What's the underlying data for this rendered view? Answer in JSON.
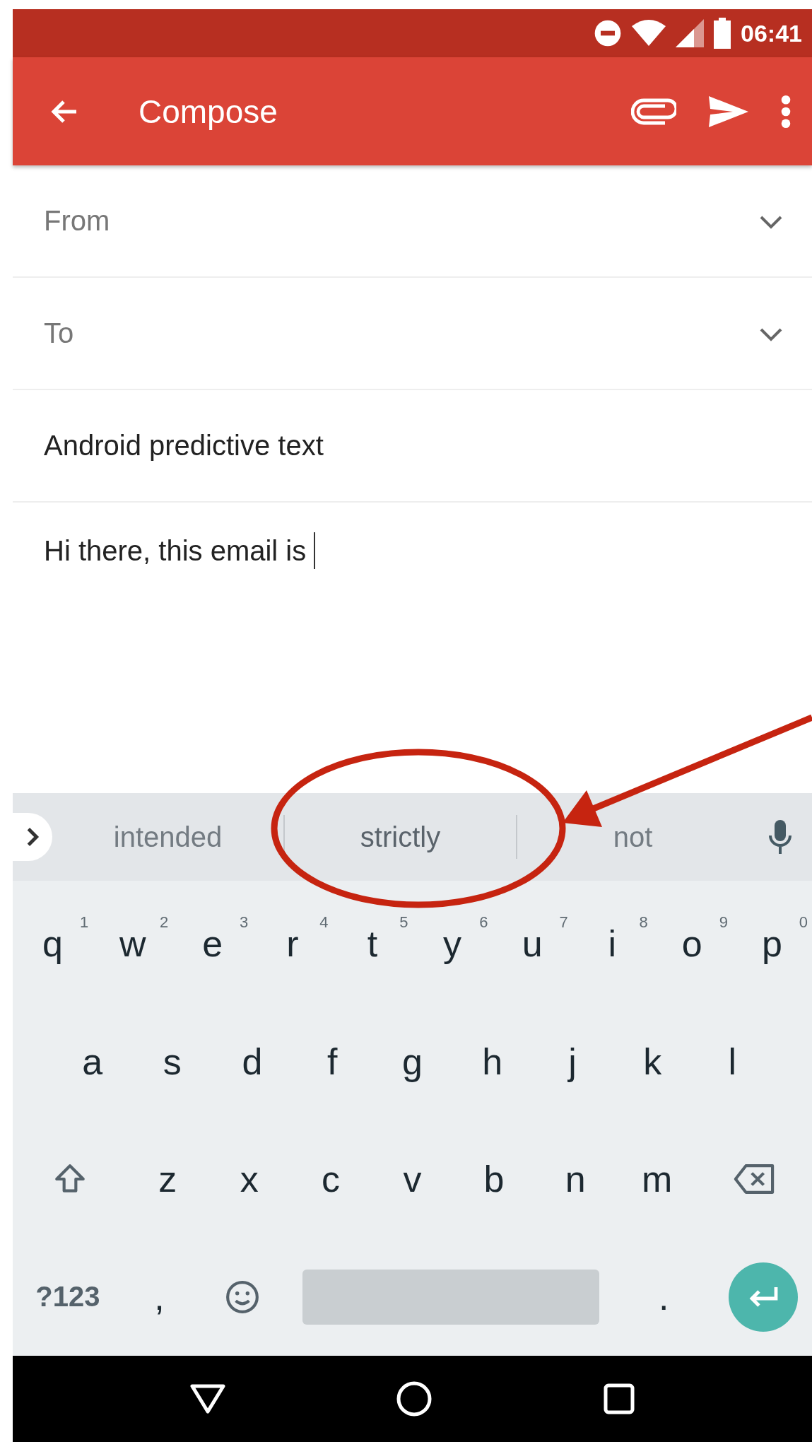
{
  "status_bar": {
    "time": "06:41"
  },
  "app_bar": {
    "title": "Compose"
  },
  "fields": [
    {
      "kind": "dropdown",
      "placeholder": "From"
    },
    {
      "kind": "dropdown",
      "placeholder": "To"
    },
    {
      "kind": "text",
      "value": "Android predictive text"
    }
  ],
  "body": {
    "value": "Hi there, this email is "
  },
  "suggestions": [
    {
      "label": "intended",
      "selected": false
    },
    {
      "label": "strictly",
      "selected": true
    },
    {
      "label": "not",
      "selected": false
    }
  ],
  "keyboard": {
    "rows": [
      [
        {
          "kind": "char",
          "label": "q",
          "hint": "1"
        },
        {
          "kind": "char",
          "label": "w",
          "hint": "2"
        },
        {
          "kind": "char",
          "label": "e",
          "hint": "3"
        },
        {
          "kind": "char",
          "label": "r",
          "hint": "4"
        },
        {
          "kind": "char",
          "label": "t",
          "hint": "5"
        },
        {
          "kind": "char",
          "label": "y",
          "hint": "6"
        },
        {
          "kind": "char",
          "label": "u",
          "hint": "7"
        },
        {
          "kind": "char",
          "label": "i",
          "hint": "8"
        },
        {
          "kind": "char",
          "label": "o",
          "hint": "9"
        },
        {
          "kind": "char",
          "label": "p",
          "hint": "0"
        }
      ],
      [
        {
          "kind": "char",
          "label": "a"
        },
        {
          "kind": "char",
          "label": "s"
        },
        {
          "kind": "char",
          "label": "d"
        },
        {
          "kind": "char",
          "label": "f"
        },
        {
          "kind": "char",
          "label": "g"
        },
        {
          "kind": "char",
          "label": "h"
        },
        {
          "kind": "char",
          "label": "j"
        },
        {
          "kind": "char",
          "label": "k"
        },
        {
          "kind": "char",
          "label": "l"
        }
      ],
      [
        {
          "kind": "shift"
        },
        {
          "kind": "char",
          "label": "z"
        },
        {
          "kind": "char",
          "label": "x"
        },
        {
          "kind": "char",
          "label": "c"
        },
        {
          "kind": "char",
          "label": "v"
        },
        {
          "kind": "char",
          "label": "b"
        },
        {
          "kind": "char",
          "label": "n"
        },
        {
          "kind": "char",
          "label": "m"
        },
        {
          "kind": "backspace"
        }
      ],
      [
        {
          "kind": "symbols",
          "label": "?123"
        },
        {
          "kind": "char",
          "label": ","
        },
        {
          "kind": "emoji"
        },
        {
          "kind": "space"
        },
        {
          "kind": "char",
          "label": "."
        },
        {
          "kind": "enter"
        }
      ]
    ]
  }
}
